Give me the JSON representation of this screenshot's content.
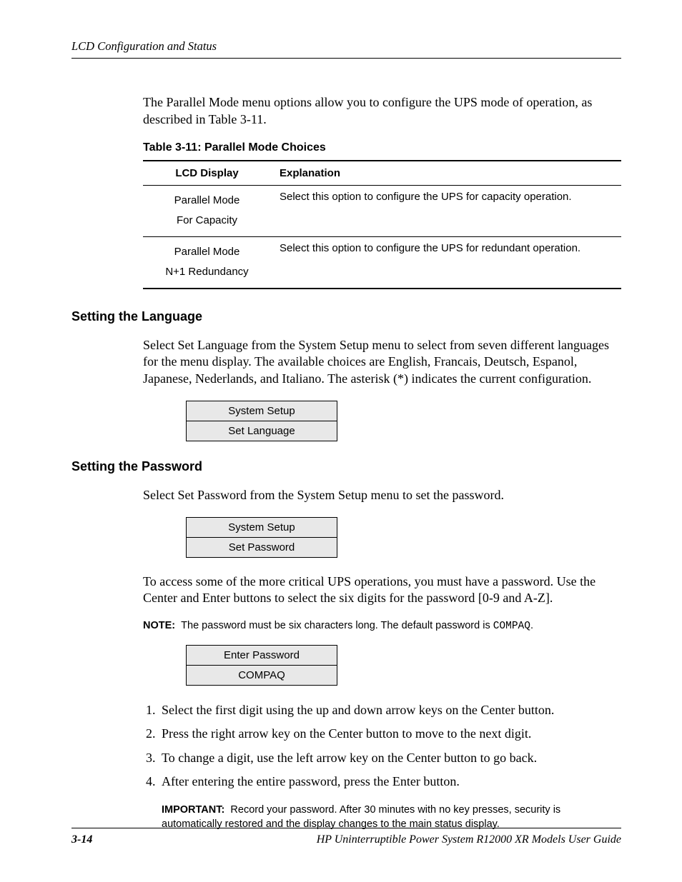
{
  "header": {
    "running": "LCD Configuration and Status"
  },
  "intro": "The Parallel Mode menu options allow you to configure the UPS mode of operation, as described in Table 3-11.",
  "table": {
    "caption": "Table 3-11:  Parallel Mode Choices",
    "head": {
      "c1": "LCD Display",
      "c2": "Explanation"
    },
    "rows": [
      {
        "lcd_l1": "Parallel Mode",
        "lcd_l2": "For Capacity",
        "exp": "Select this option to configure the UPS for capacity operation."
      },
      {
        "lcd_l1": "Parallel Mode",
        "lcd_l2": "N+1 Redundancy",
        "exp": "Select this option to configure the UPS for redundant operation."
      }
    ]
  },
  "lang": {
    "heading": "Setting the Language",
    "para": "Select Set Language from the System Setup menu to select from seven different languages for the menu display. The available choices are English, Francais, Deutsch, Espanol, Japanese, Nederlands, and Italiano. The asterisk (*) indicates the current configuration.",
    "lcd": {
      "l1": "System Setup",
      "l2": "Set Language"
    }
  },
  "pwd": {
    "heading": "Setting the Password",
    "para1": "Select Set Password from the System Setup menu to set the password.",
    "lcd1": {
      "l1": "System Setup",
      "l2": "Set Password"
    },
    "para2": "To access some of the more critical UPS operations, you must have a password. Use the Center and Enter buttons to select the six digits for the password [0-9 and A-Z].",
    "note_label": "NOTE:",
    "note_text": "The password must be six characters long. The default password is ",
    "note_code": "COMPAQ",
    "note_suffix": ".",
    "lcd2": {
      "l1": "Enter Password",
      "l2": "COMPAQ"
    },
    "steps": [
      "Select the first digit using the up and down arrow keys on the Center button.",
      "Press the right arrow key on the Center button to move to the next digit.",
      "To change a digit, use the left arrow key on the Center button to go back.",
      "After entering the entire password, press the Enter button."
    ],
    "important_label": "IMPORTANT:",
    "important_text": "Record your password. After 30 minutes with no key presses, security is automatically restored and the display changes to the main status display."
  },
  "footer": {
    "page": "3-14",
    "title": "HP Uninterruptible Power System R12000 XR Models User Guide"
  }
}
